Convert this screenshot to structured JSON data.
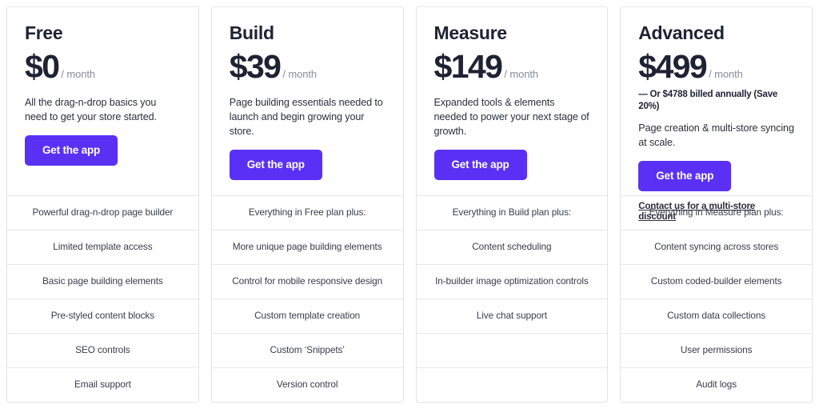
{
  "accent_color": "#5a31f4",
  "text_color": "#1f2233",
  "muted_color": "#8b8d98",
  "border_color": "#e4e4e7",
  "plans": [
    {
      "name": "Free",
      "price": "$0",
      "period": "/ month",
      "annual_note": "",
      "description": "All the drag-n-drop basics you need to get your store started.",
      "cta_label": "Get the app",
      "secondary_link": "",
      "features": [
        "Powerful drag-n-drop page builder",
        "Limited template access",
        "Basic page building elements",
        "Pre-styled content blocks",
        "SEO controls",
        "Email support"
      ]
    },
    {
      "name": "Build",
      "price": "$39",
      "period": "/ month",
      "annual_note": "",
      "description": "Page building essentials needed to launch and begin growing your store.",
      "cta_label": "Get the app",
      "secondary_link": "",
      "features": [
        "Everything in Free plan plus:",
        "More unique page building elements",
        "Control for mobile responsive design",
        "Custom template creation",
        "Custom ‘Snippets’",
        "Version control"
      ]
    },
    {
      "name": "Measure",
      "price": "$149",
      "period": "/ month",
      "annual_note": "",
      "description": "Expanded tools & elements needed to power your next stage of growth.",
      "cta_label": "Get the app",
      "secondary_link": "",
      "features": [
        "Everything in Build plan plus:",
        "Content scheduling",
        "In-builder image optimization controls",
        "Live chat support",
        "",
        ""
      ]
    },
    {
      "name": "Advanced",
      "price": "$499",
      "period": "/ month",
      "annual_note": "— Or $4788 billed annually (Save 20%)",
      "description": "Page creation & multi-store syncing at scale.",
      "cta_label": "Get the app",
      "secondary_link": "Contact us for a multi-store discount",
      "features": [
        "Everything in Measure plan plus:",
        "Content syncing across stores",
        "Custom coded-builder elements",
        "Custom data collections",
        "User permissions",
        "Audit logs"
      ]
    }
  ]
}
